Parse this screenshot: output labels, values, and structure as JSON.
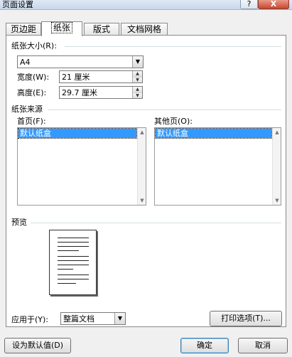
{
  "window": {
    "title": "页面设置",
    "help_label": "?",
    "close_label": "X"
  },
  "tabs": [
    {
      "label": "页边距"
    },
    {
      "label": "纸张"
    },
    {
      "label": "版式"
    },
    {
      "label": "文档网格"
    }
  ],
  "paper_size": {
    "section_label": "纸张大小(R):",
    "selected": "A4",
    "width_label": "宽度(W):",
    "width_value": "21 厘米",
    "height_label": "高度(E):",
    "height_value": "29.7 厘米"
  },
  "paper_source": {
    "section_label": "纸张来源",
    "first_page_label": "首页(F):",
    "first_page_selected": "默认纸盒",
    "other_pages_label": "其他页(O):",
    "other_pages_selected": "默认纸盒"
  },
  "preview": {
    "section_label": "预览",
    "apply_to_label": "应用于(Y):",
    "apply_to_value": "整篇文档",
    "print_options_label": "打印选项(T)..."
  },
  "footer": {
    "set_default_label": "设为默认值(D)",
    "ok_label": "确定",
    "cancel_label": "取消"
  }
}
